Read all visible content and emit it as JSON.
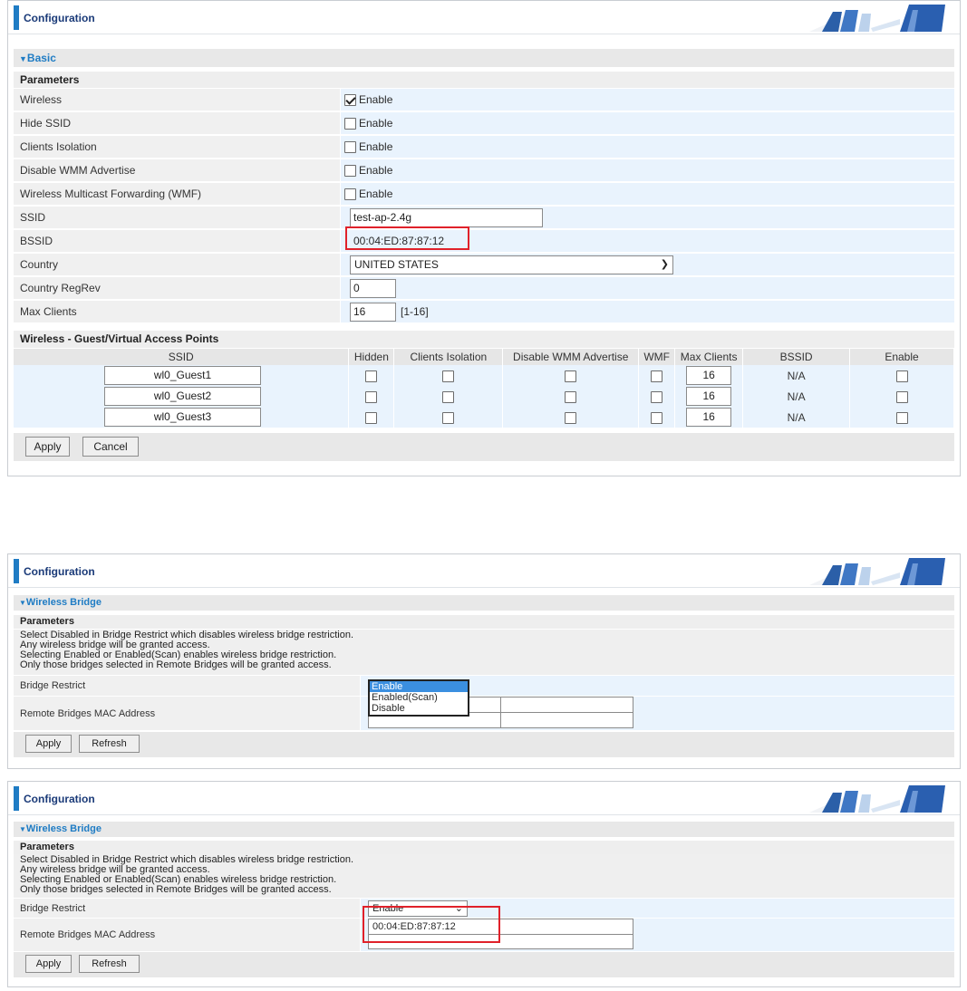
{
  "panel1": {
    "header_title": "Configuration",
    "section_title": "Basic",
    "params_title": "Parameters",
    "wireless": {
      "label": "Wireless",
      "checkbox_label": "Enable",
      "checked": true
    },
    "hide_ssid": {
      "label": "Hide SSID",
      "checkbox_label": "Enable",
      "checked": false
    },
    "clients_isolation": {
      "label": "Clients Isolation",
      "checkbox_label": "Enable",
      "checked": false
    },
    "disable_wmm": {
      "label": "Disable WMM Advertise",
      "checkbox_label": "Enable",
      "checked": false
    },
    "wmf": {
      "label": "Wireless Multicast Forwarding (WMF)",
      "checkbox_label": "Enable",
      "checked": false
    },
    "ssid": {
      "label": "SSID",
      "value": "test-ap-2.4g"
    },
    "bssid": {
      "label": "BSSID",
      "value": "00:04:ED:87:87:12"
    },
    "country": {
      "label": "Country",
      "value": "UNITED STATES"
    },
    "country_regrev": {
      "label": "Country RegRev",
      "value": "0"
    },
    "max_clients": {
      "label": "Max Clients",
      "value": "16",
      "range_hint": "[1-16]"
    },
    "guest_section_title": "Wireless - Guest/Virtual Access Points",
    "guest_columns": [
      "SSID",
      "Hidden",
      "Clients Isolation",
      "Disable WMM Advertise",
      "WMF",
      "Max Clients",
      "BSSID",
      "Enable"
    ],
    "guest_rows": [
      {
        "ssid": "wl0_Guest1",
        "max_clients": "16",
        "bssid": "N/A"
      },
      {
        "ssid": "wl0_Guest2",
        "max_clients": "16",
        "bssid": "N/A"
      },
      {
        "ssid": "wl0_Guest3",
        "max_clients": "16",
        "bssid": "N/A"
      }
    ],
    "apply_label": "Apply",
    "cancel_label": "Cancel"
  },
  "panel2": {
    "header_title": "Configuration",
    "section_title": "Wireless Bridge",
    "params_title": "Parameters",
    "desc_lines": [
      "Select Disabled in Bridge Restrict which disables wireless bridge restriction.",
      "Any wireless bridge will be granted access.",
      "Selecting Enabled or Enabled(Scan) enables wireless bridge restriction.",
      "Only those bridges selected in Remote Bridges will be granted access."
    ],
    "bridge_restrict_label": "Bridge Restrict",
    "dropdown_options": [
      "Enable",
      "Enabled(Scan)",
      "Disable"
    ],
    "dropdown_highlighted": "Enable",
    "remote_bridges_label": "Remote Bridges MAC Address",
    "apply_label": "Apply",
    "refresh_label": "Refresh"
  },
  "panel3": {
    "header_title": "Configuration",
    "section_title": "Wireless Bridge",
    "params_title": "Parameters",
    "desc_lines": [
      "Select Disabled in Bridge Restrict which disables wireless bridge restriction.",
      "Any wireless bridge will be granted access.",
      "Selecting Enabled or Enabled(Scan) enables wireless bridge restriction.",
      "Only those bridges selected in Remote Bridges will be granted access."
    ],
    "bridge_restrict_label": "Bridge Restrict",
    "bridge_restrict_value": "Enable",
    "remote_bridges_label": "Remote Bridges MAC Address",
    "remote_mac_value": "00:04:ED:87:87:12",
    "apply_label": "Apply",
    "refresh_label": "Refresh"
  },
  "colors": {
    "accent_blue": "#1f7cc4",
    "value_cell_bg": "#e9f3fd",
    "label_cell_bg": "#f0f0f0",
    "highlight_red": "#e0212a"
  }
}
